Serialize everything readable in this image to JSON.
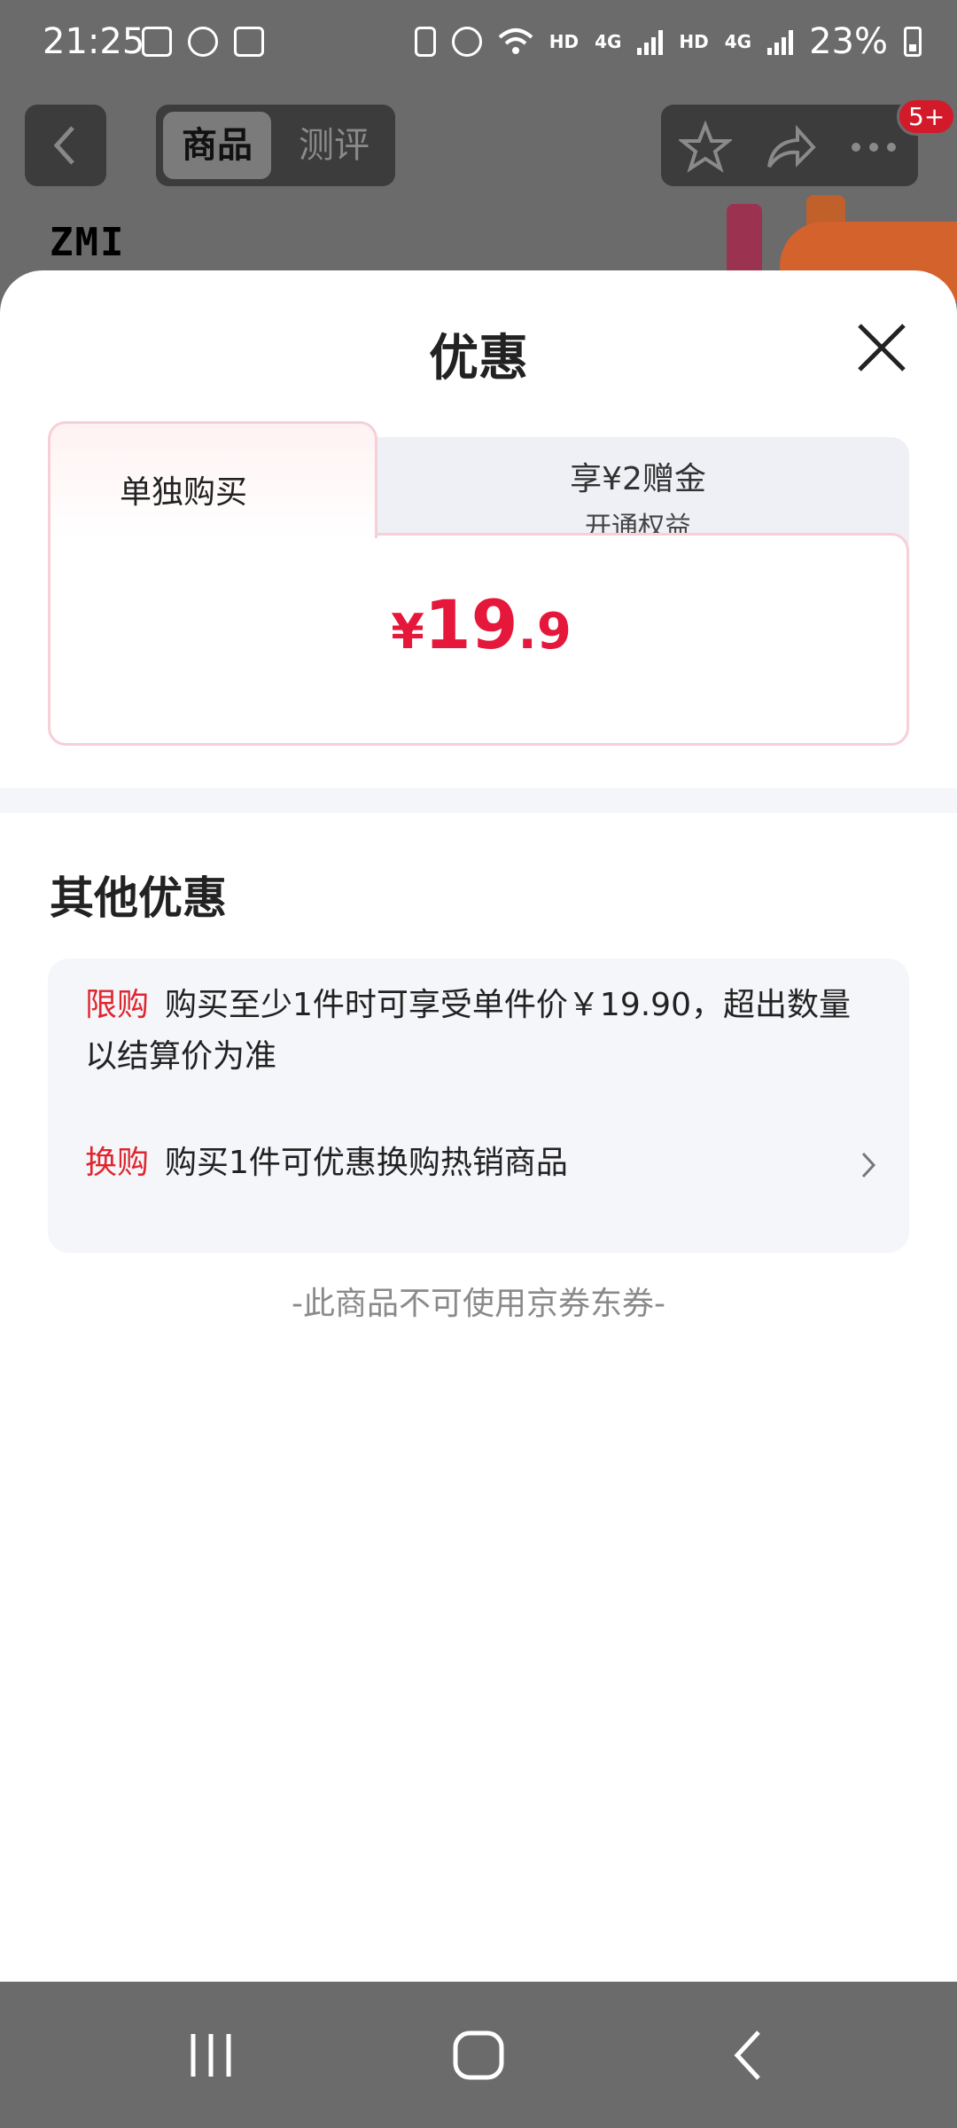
{
  "status_bar": {
    "time": "21:25",
    "battery": "23%",
    "hd1": "HD",
    "hd2": "HD",
    "net1": "4G",
    "net2": "4G"
  },
  "header": {
    "tabs": [
      "商品",
      "测评"
    ],
    "badge": "5+",
    "brand": "ZMI"
  },
  "sheet": {
    "title": "优惠",
    "tab_active_label": "单独购买",
    "tab_inactive_label": "享¥2赠金",
    "tab_inactive_sub": "开通权益",
    "price_currency": "¥",
    "price_integer": "19",
    "price_decimal": ".9",
    "section_title": "其他优惠",
    "offers": [
      {
        "tag": "限购",
        "text": "购买至少1件时可享受单件价￥19.90，超出数量以结算价为准"
      },
      {
        "tag": "换购",
        "text": "购买1件可优惠换购热销商品"
      }
    ],
    "note": "-此商品不可使用京券东券-"
  },
  "colors": {
    "accent": "#e5173b",
    "tag_red": "#e0262f",
    "overlay": "#6b6b6b"
  }
}
